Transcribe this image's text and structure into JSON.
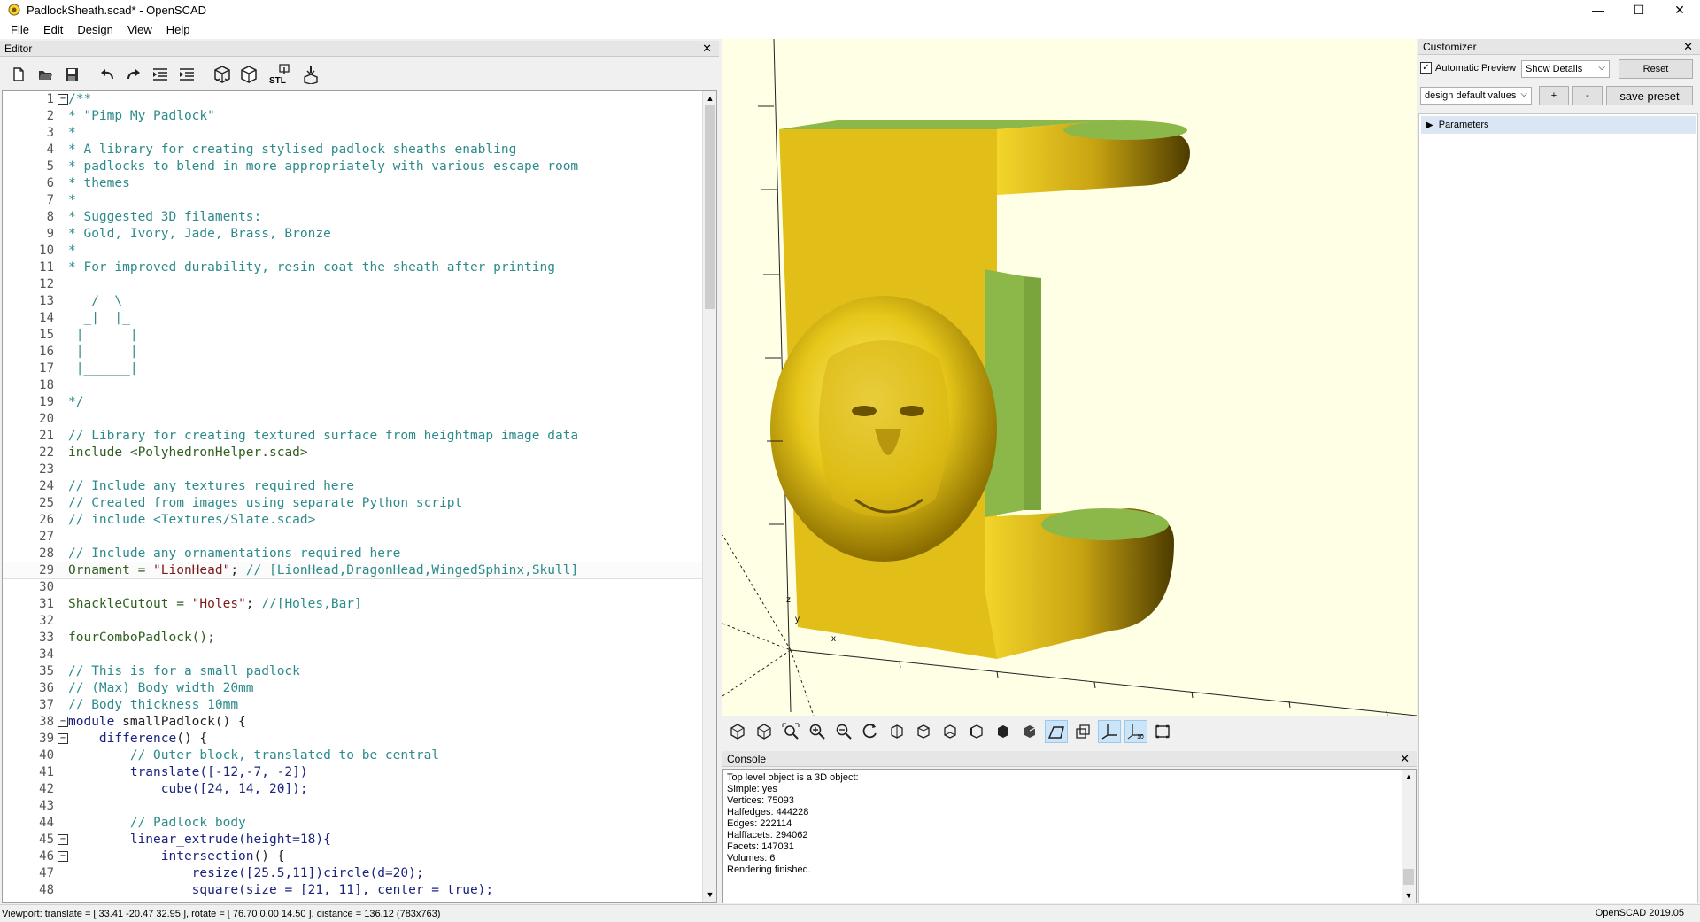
{
  "window": {
    "title": "PadlockSheath.scad* - OpenSCAD",
    "minimize": "—",
    "maximize": "☐",
    "close": "✕"
  },
  "menu": {
    "items": [
      {
        "label": "File"
      },
      {
        "label": "Edit"
      },
      {
        "label": "Design"
      },
      {
        "label": "View"
      },
      {
        "label": "Help"
      }
    ]
  },
  "editor": {
    "title": "Editor",
    "close": "✕",
    "toolbar": {
      "new_icon": "new-file-icon",
      "open_icon": "open-folder-icon",
      "save_icon": "save-icon",
      "undo_icon": "undo-icon",
      "redo_icon": "redo-icon",
      "unindent_icon": "unindent-icon",
      "indent_icon": "indent-icon",
      "preview_icon": "preview-icon",
      "render_icon": "render-icon",
      "stl_label": "STL",
      "print_icon": "3d-print-icon"
    },
    "lines": [
      {
        "n": "1",
        "fold": "−",
        "parts": [
          {
            "t": "/**",
            "c": "comment"
          }
        ]
      },
      {
        "n": "2",
        "parts": [
          {
            "t": "* \"Pimp My Padlock\"",
            "c": "comment"
          }
        ]
      },
      {
        "n": "3",
        "parts": [
          {
            "t": "*",
            "c": "comment"
          }
        ]
      },
      {
        "n": "4",
        "parts": [
          {
            "t": "* A library for creating stylised padlock sheaths enabling",
            "c": "comment"
          }
        ]
      },
      {
        "n": "5",
        "parts": [
          {
            "t": "* padlocks to blend in more appropriately with various escape room",
            "c": "comment"
          }
        ]
      },
      {
        "n": "6",
        "parts": [
          {
            "t": "* themes",
            "c": "comment"
          }
        ]
      },
      {
        "n": "7",
        "parts": [
          {
            "t": "*",
            "c": "comment"
          }
        ]
      },
      {
        "n": "8",
        "parts": [
          {
            "t": "* Suggested 3D filaments:",
            "c": "comment"
          }
        ]
      },
      {
        "n": "9",
        "parts": [
          {
            "t": "* Gold, Ivory, Jade, Brass, Bronze",
            "c": "comment"
          }
        ]
      },
      {
        "n": "10",
        "parts": [
          {
            "t": "*",
            "c": "comment"
          }
        ]
      },
      {
        "n": "11",
        "parts": [
          {
            "t": "* For improved durability, resin coat the sheath after printing",
            "c": "comment"
          }
        ]
      },
      {
        "n": "12",
        "parts": [
          {
            "t": "    __",
            "c": "comment"
          }
        ]
      },
      {
        "n": "13",
        "parts": [
          {
            "t": "   /  \\",
            "c": "comment"
          }
        ]
      },
      {
        "n": "14",
        "parts": [
          {
            "t": "  _|  |_",
            "c": "comment"
          }
        ]
      },
      {
        "n": "15",
        "parts": [
          {
            "t": " |      |",
            "c": "comment"
          }
        ]
      },
      {
        "n": "16",
        "parts": [
          {
            "t": " |      |",
            "c": "comment"
          }
        ]
      },
      {
        "n": "17",
        "parts": [
          {
            "t": " |______|",
            "c": "comment"
          }
        ]
      },
      {
        "n": "18",
        "parts": [
          {
            "t": "",
            "c": "comment"
          }
        ]
      },
      {
        "n": "19",
        "parts": [
          {
            "t": "*/",
            "c": "comment"
          }
        ]
      },
      {
        "n": "20",
        "parts": [
          {
            "t": "",
            "c": "fn"
          }
        ]
      },
      {
        "n": "21",
        "parts": [
          {
            "t": "// Library for creating textured surface from heightmap image data",
            "c": "comment"
          }
        ]
      },
      {
        "n": "22",
        "parts": [
          {
            "t": "include ",
            "c": "def"
          },
          {
            "t": "<PolyhedronHelper.scad>",
            "c": "def"
          }
        ]
      },
      {
        "n": "23",
        "parts": [
          {
            "t": "",
            "c": "fn"
          }
        ]
      },
      {
        "n": "24",
        "parts": [
          {
            "t": "// Include any textures required here",
            "c": "comment"
          }
        ]
      },
      {
        "n": "25",
        "parts": [
          {
            "t": "// Created from images using separate Python script",
            "c": "comment"
          }
        ]
      },
      {
        "n": "26",
        "parts": [
          {
            "t": "// include <Textures/Slate.scad>",
            "c": "comment"
          }
        ]
      },
      {
        "n": "27",
        "parts": [
          {
            "t": "",
            "c": "fn"
          }
        ]
      },
      {
        "n": "28",
        "parts": [
          {
            "t": "// Include any ornamentations required here",
            "c": "comment"
          }
        ]
      },
      {
        "n": "29",
        "current": true,
        "parts": [
          {
            "t": "Ornament = ",
            "c": "def"
          },
          {
            "t": "\"LionHead\"",
            "c": "str"
          },
          {
            "t": "; ",
            "c": "fn"
          },
          {
            "t": "// [LionHead,DragonHead,WingedSphinx,Skull]",
            "c": "comment"
          }
        ]
      },
      {
        "n": "30",
        "parts": [
          {
            "t": "",
            "c": "fn"
          }
        ]
      },
      {
        "n": "31",
        "parts": [
          {
            "t": "ShackleCutout = ",
            "c": "def"
          },
          {
            "t": "\"Holes\"",
            "c": "str"
          },
          {
            "t": "; ",
            "c": "fn"
          },
          {
            "t": "//[Holes,Bar]",
            "c": "comment"
          }
        ]
      },
      {
        "n": "32",
        "parts": [
          {
            "t": "",
            "c": "fn"
          }
        ]
      },
      {
        "n": "33",
        "parts": [
          {
            "t": "fourComboPadlock();",
            "c": "def"
          }
        ]
      },
      {
        "n": "34",
        "parts": [
          {
            "t": "",
            "c": "fn"
          }
        ]
      },
      {
        "n": "35",
        "parts": [
          {
            "t": "// This is for a small padlock",
            "c": "comment"
          }
        ]
      },
      {
        "n": "36",
        "parts": [
          {
            "t": "// (Max) Body width 20mm",
            "c": "comment"
          }
        ]
      },
      {
        "n": "37",
        "parts": [
          {
            "t": "// Body thickness 10mm",
            "c": "comment"
          }
        ]
      },
      {
        "n": "38",
        "fold": "−",
        "parts": [
          {
            "t": "module ",
            "c": "kw"
          },
          {
            "t": "smallPadlock() {",
            "c": "fn"
          }
        ]
      },
      {
        "n": "39",
        "fold": "−",
        "parts": [
          {
            "t": "    difference",
            "c": "kw"
          },
          {
            "t": "() {",
            "c": "fn"
          }
        ]
      },
      {
        "n": "40",
        "parts": [
          {
            "t": "        // Outer block, translated to be central",
            "c": "comment"
          }
        ]
      },
      {
        "n": "41",
        "parts": [
          {
            "t": "        translate",
            "c": "kw"
          },
          {
            "t": "([-12,-7, -2])",
            "c": "num"
          }
        ]
      },
      {
        "n": "42",
        "parts": [
          {
            "t": "            cube",
            "c": "kw"
          },
          {
            "t": "([24, 14, 20]);",
            "c": "num"
          }
        ]
      },
      {
        "n": "43",
        "parts": [
          {
            "t": "",
            "c": "fn"
          }
        ]
      },
      {
        "n": "44",
        "parts": [
          {
            "t": "        // Padlock body",
            "c": "comment"
          }
        ]
      },
      {
        "n": "45",
        "fold": "−",
        "parts": [
          {
            "t": "        linear_extrude",
            "c": "kw"
          },
          {
            "t": "(height=18){",
            "c": "num"
          }
        ]
      },
      {
        "n": "46",
        "fold": "−",
        "parts": [
          {
            "t": "            intersection",
            "c": "kw"
          },
          {
            "t": "() {",
            "c": "fn"
          }
        ]
      },
      {
        "n": "47",
        "parts": [
          {
            "t": "                resize",
            "c": "kw"
          },
          {
            "t": "([25.5,11])",
            "c": "num"
          },
          {
            "t": "circle",
            "c": "kw"
          },
          {
            "t": "(d=20);",
            "c": "num"
          }
        ]
      },
      {
        "n": "48",
        "parts": [
          {
            "t": "                square",
            "c": "kw"
          },
          {
            "t": "(size = [21, 11], center = true);",
            "c": "num"
          }
        ]
      }
    ]
  },
  "console": {
    "title": "Console",
    "close": "✕",
    "lines": [
      "Top level object is a 3D object:",
      "Simple: yes",
      "Vertices: 75093",
      "Halfedges: 444228",
      "Edges: 222114",
      "Halffacets: 294062",
      "Facets: 147031",
      "Volumes: 6",
      "Rendering finished."
    ]
  },
  "viewport": {
    "axis_z": "z",
    "axis_y": "y",
    "axis_x": "x"
  },
  "customizer": {
    "title": "Customizer",
    "close": "✕",
    "auto_preview_label": "Automatic Preview",
    "auto_preview_checked": "✓",
    "details_select": "Show Details",
    "reset": "Reset",
    "preset_select": "design default values",
    "plus": "+",
    "minus": "-",
    "save_preset": "save preset",
    "parameters": "Parameters"
  },
  "status": {
    "viewport": "Viewport: translate = [ 33.41 -20.47 32.95 ], rotate = [ 76.70 0.00 14.50 ], distance = 136.12 (783x763)",
    "version": "OpenSCAD 2019.05"
  },
  "colors": {
    "model_yellow": "#e6c619",
    "model_green": "#8cb84a",
    "viewport_bg": "#ffffe5"
  }
}
